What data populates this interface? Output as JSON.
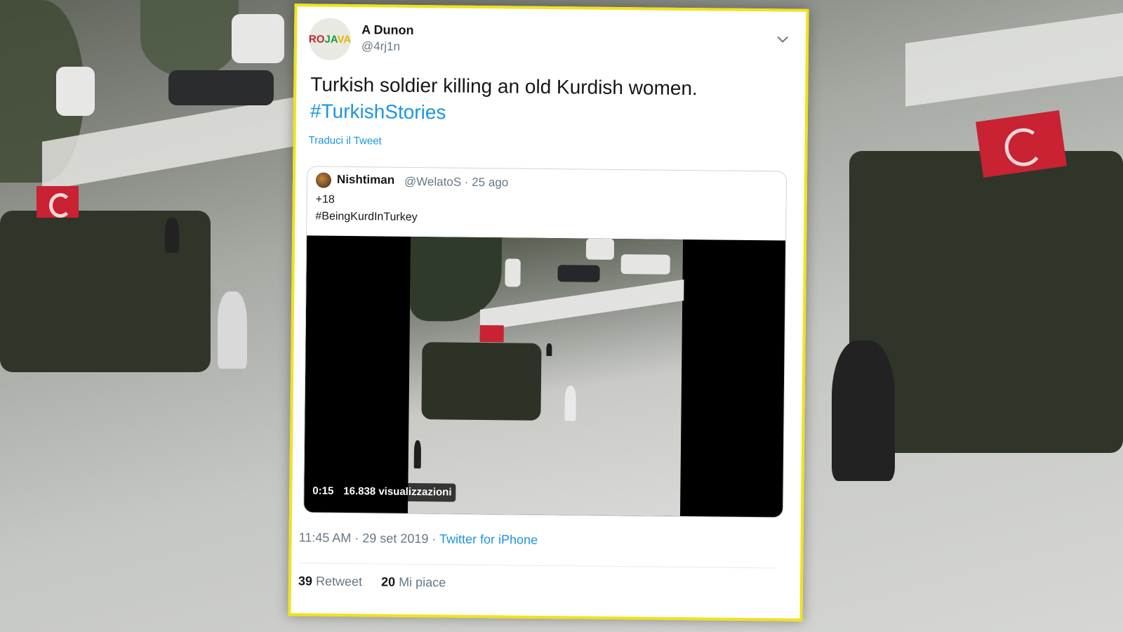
{
  "tweet": {
    "display_name": "A Dunon",
    "handle": "@4rj1n",
    "avatar_text": "ROJAVA",
    "text": "Turkish soldier killing an old Kurdish women.",
    "hashtag": "#TurkishStories",
    "translate_label": "Traduci il Tweet",
    "timestamp": "11:45 AM · 29 set 2019 · ",
    "source": "Twitter for iPhone",
    "retweets": "39",
    "retweets_label": "Retweet",
    "likes": "20",
    "likes_label": "Mi piace"
  },
  "quoted_tweet": {
    "display_name": "Nishtiman",
    "meta": "@WelatoS · 25 ago",
    "line1": "+18",
    "line2": "#BeingKurdInTurkey",
    "video_duration": "0:15",
    "video_views": "16.838 visualizzazioni"
  },
  "colors": {
    "card_border": "#f2e21a",
    "link": "#1b95e0",
    "text": "#14171a",
    "muted": "#657786"
  }
}
